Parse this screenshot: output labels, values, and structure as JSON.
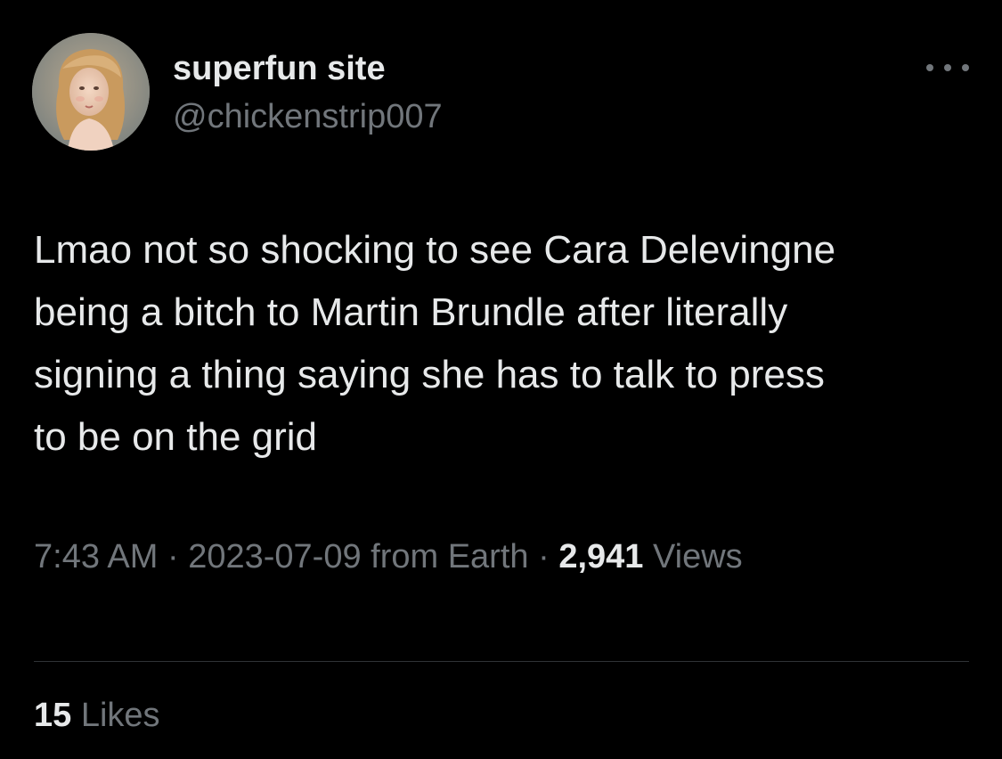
{
  "author": {
    "display_name": "superfun site",
    "handle": "@chickenstrip007",
    "avatar_icon": "portrait-avatar-icon"
  },
  "menu": {
    "icon": "more-options-icon"
  },
  "tweet": {
    "text": "Lmao not so shocking to see Cara Delevingne\nbeing a bitch to Martin Brundle after literally\nsigning a thing saying she has to talk to press\nto be on the grid"
  },
  "meta": {
    "time": "7:43 AM",
    "separator": " · ",
    "date_source": "2023-07-09 from Earth",
    "views_count": "2,941",
    "views_label": " Views"
  },
  "stats": {
    "likes_count": "15",
    "likes_label": " Likes"
  },
  "colors": {
    "background": "#000000",
    "primary_text": "#e7e9ea",
    "secondary_text": "#71767b",
    "divider": "#2f3336"
  }
}
